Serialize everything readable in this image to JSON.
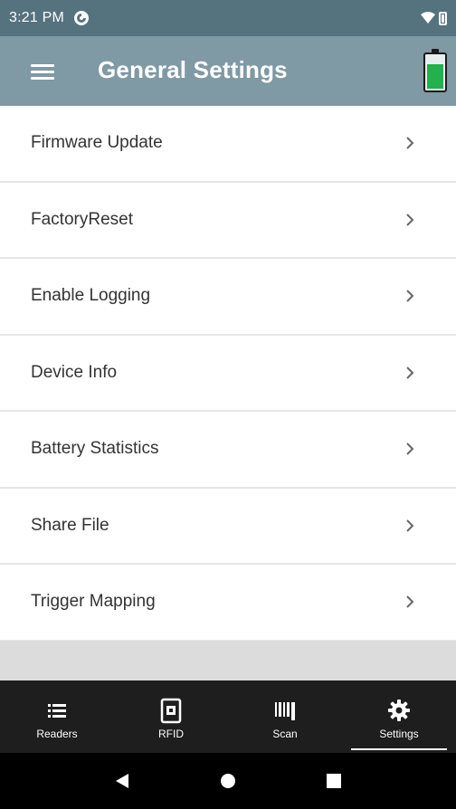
{
  "status_bar": {
    "time": "3:21 PM"
  },
  "app_bar": {
    "title": "General Settings"
  },
  "settings_list": {
    "items": [
      {
        "label": "Firmware Update"
      },
      {
        "label": "FactoryReset"
      },
      {
        "label": "Enable Logging"
      },
      {
        "label": "Device Info"
      },
      {
        "label": "Battery Statistics"
      },
      {
        "label": "Share File"
      },
      {
        "label": "Trigger Mapping"
      }
    ]
  },
  "bottom_nav": {
    "tabs": [
      {
        "label": "Readers",
        "icon": "list-icon"
      },
      {
        "label": "RFID",
        "icon": "rfid-tag-icon"
      },
      {
        "label": "Scan",
        "icon": "barcode-icon"
      },
      {
        "label": "Settings",
        "icon": "gear-icon",
        "active": true
      }
    ]
  },
  "colors": {
    "status_bar": "#55727f",
    "app_bar": "#7f99a5",
    "battery_fill": "#22b14c",
    "bottom_nav": "#1e1e1e"
  }
}
